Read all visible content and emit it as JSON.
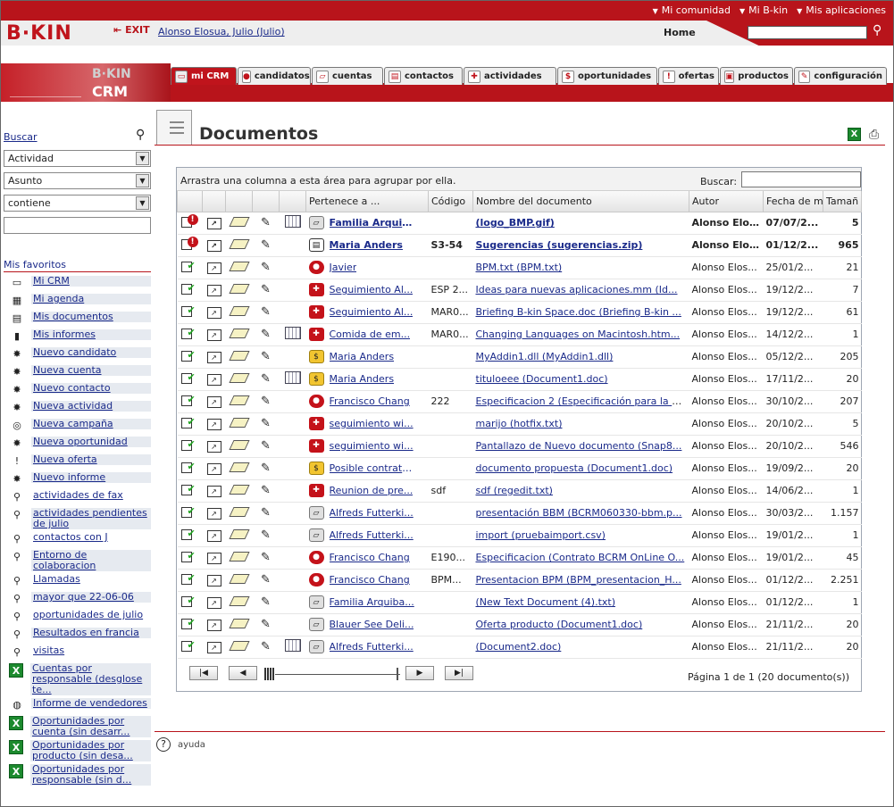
{
  "topbar": {
    "links": [
      "Mi comunidad",
      "Mi B-kin",
      "Mis aplicaciones"
    ]
  },
  "header": {
    "logo": "B·KIN",
    "exit_label": "EXIT",
    "user": "Alonso Elosua, Julio (Julio)",
    "home": "Home",
    "search_value": ""
  },
  "crm_band": {
    "brand": "B·KIN",
    "product": "CRM"
  },
  "tabs": [
    {
      "label": "mi CRM",
      "icon": "monitor-icon",
      "active": true
    },
    {
      "label": "candidatos",
      "icon": "person-icon"
    },
    {
      "label": "cuentas",
      "icon": "folder-icon"
    },
    {
      "label": "contactos",
      "icon": "contact-card-icon"
    },
    {
      "label": "actividades",
      "icon": "activity-icon"
    },
    {
      "label": "oportunidades",
      "icon": "coins-icon"
    },
    {
      "label": "ofertas",
      "icon": "exclamation-icon"
    },
    {
      "label": "productos",
      "icon": "box-icon"
    },
    {
      "label": "configuración",
      "icon": "wrench-icon"
    }
  ],
  "sidebar": {
    "buscar": "Buscar",
    "filters": [
      "Actividad",
      "Asunto",
      "contiene"
    ],
    "text_value": "",
    "fav_title": "Mis favoritos",
    "favs": [
      {
        "label": "Mi CRM",
        "icon": "monitor-icon"
      },
      {
        "label": "Mi agenda",
        "icon": "calendar-icon"
      },
      {
        "label": "Mis documentos",
        "icon": "document-icon"
      },
      {
        "label": "Mis informes",
        "icon": "bar-chart-icon"
      },
      {
        "label": "Nuevo candidato",
        "icon": "new-candidate-icon"
      },
      {
        "label": "Nueva cuenta",
        "icon": "new-account-icon"
      },
      {
        "label": "Nuevo contacto",
        "icon": "new-contact-icon"
      },
      {
        "label": "Nueva actividad",
        "icon": "new-activity-icon"
      },
      {
        "label": "Nueva campaña",
        "icon": "new-campaign-icon"
      },
      {
        "label": "Nueva oportunidad",
        "icon": "new-opportunity-icon"
      },
      {
        "label": "Nueva oferta",
        "icon": "new-offer-icon"
      },
      {
        "label": "Nuevo informe",
        "icon": "new-report-icon"
      },
      {
        "label": "actividades de fax",
        "icon": "magnifier-icon"
      },
      {
        "label": "actividades pendientes de julio",
        "icon": "magnifier-icon"
      },
      {
        "label": "contactos con J",
        "icon": "magnifier-icon"
      },
      {
        "label": "Entorno de colaboracion",
        "icon": "magnifier-icon"
      },
      {
        "label": "Llamadas",
        "icon": "magnifier-icon"
      },
      {
        "label": "mayor que 22-06-06",
        "icon": "magnifier-icon"
      },
      {
        "label": "oportunidades de julio",
        "icon": "magnifier-icon"
      },
      {
        "label": "Resultados en francia",
        "icon": "magnifier-icon"
      },
      {
        "label": "visitas",
        "icon": "magnifier-icon"
      },
      {
        "label": "Cuentas por responsable (desglose te...",
        "icon": "excel-icon"
      },
      {
        "label": "Informe de vendedores",
        "icon": "globe-icon"
      },
      {
        "label": "Oportunidades por cuenta (sin desarr...",
        "icon": "excel-icon"
      },
      {
        "label": "Oportunidades por producto (sin desa...",
        "icon": "excel-icon"
      },
      {
        "label": "Oportunidades por responsable (sin d...",
        "icon": "excel-icon"
      }
    ]
  },
  "main": {
    "title": "Documentos",
    "group_hint": "Arrastra una columna a esta área para agrupar por ella.",
    "search_label": "Buscar:",
    "columns": [
      "Pertenece a ...",
      "Código",
      "Nombre del documento",
      "Autor",
      "Fecha de m",
      "Tamañ"
    ],
    "rows": [
      {
        "state": "bad",
        "cal": true,
        "type": "cuentas",
        "pertenece": "Familia Arquib...",
        "codigo": "",
        "nombre": "(logo_BMP.gif)",
        "autor": "Alonso Elos...",
        "fecha": "07/07/2...",
        "tam": "5",
        "bold": true
      },
      {
        "state": "bad",
        "cal": false,
        "type": "contactos",
        "pertenece": "Maria Anders",
        "codigo": "S3-54",
        "nombre": "Sugerencias (sugerencias.zip)",
        "autor": "Alonso Elos...",
        "fecha": "01/12/2...",
        "tam": "965",
        "bold": true
      },
      {
        "state": "ok",
        "cal": false,
        "type": "candidatos",
        "pertenece": "Javier",
        "codigo": "",
        "nombre": "BPM.txt (BPM.txt)",
        "autor": "Alonso Elos...",
        "fecha": "25/01/2...",
        "tam": "21"
      },
      {
        "state": "ok",
        "cal": false,
        "type": "actividades",
        "pertenece": "Seguimiento Al...",
        "codigo": "ESP 2...",
        "nombre": "Ideas para nuevas aplicaciones.mm (Id...",
        "autor": "Alonso Elos...",
        "fecha": "19/12/2...",
        "tam": "7"
      },
      {
        "state": "ok",
        "cal": false,
        "type": "actividades",
        "pertenece": "Seguimiento Al...",
        "codigo": "MAR0...",
        "nombre": "Briefing B-kin Space.doc (Briefing B-kin ...",
        "autor": "Alonso Elos...",
        "fecha": "19/12/2...",
        "tam": "61"
      },
      {
        "state": "ok",
        "cal": true,
        "type": "actividades",
        "pertenece": "Comida de em...",
        "codigo": "MAR0...",
        "nombre": "Changing Languages on Macintosh.htm...",
        "autor": "Alonso Elos...",
        "fecha": "14/12/2...",
        "tam": "1"
      },
      {
        "state": "ok",
        "cal": false,
        "type": "oportunidades",
        "pertenece": "Maria Anders",
        "codigo": "",
        "nombre": "MyAddin1.dll (MyAddin1.dll)",
        "autor": "Alonso Elos...",
        "fecha": "05/12/2...",
        "tam": "205"
      },
      {
        "state": "ok",
        "cal": true,
        "type": "oportunidades",
        "pertenece": "Maria Anders",
        "codigo": "",
        "nombre": "tituloeee (Document1.doc)",
        "autor": "Alonso Elos...",
        "fecha": "17/11/2...",
        "tam": "20"
      },
      {
        "state": "ok",
        "cal": false,
        "type": "candidatos",
        "pertenece": "Francisco Chang",
        "codigo": "222",
        "nombre": "Especificacion 2 (Especificación para la a...",
        "autor": "Alonso Elos...",
        "fecha": "30/10/2...",
        "tam": "207"
      },
      {
        "state": "ok",
        "cal": false,
        "type": "actividades",
        "pertenece": "seguimiento wi...",
        "codigo": "",
        "nombre": "marijo (hotfix.txt)",
        "autor": "Alonso Elos...",
        "fecha": "20/10/2...",
        "tam": "5"
      },
      {
        "state": "ok",
        "cal": false,
        "type": "actividades",
        "pertenece": "seguimiento wi...",
        "codigo": "",
        "nombre": "Pantallazo de Nuevo documento (Snap8...",
        "autor": "Alonso Elos...",
        "fecha": "20/10/2...",
        "tam": "546"
      },
      {
        "state": "ok",
        "cal": false,
        "type": "oportunidades",
        "pertenece": "Posible contrata...",
        "codigo": "",
        "nombre": "documento propuesta (Document1.doc)",
        "autor": "Alonso Elos...",
        "fecha": "19/09/2...",
        "tam": "20"
      },
      {
        "state": "ok",
        "cal": false,
        "type": "actividades",
        "pertenece": "Reunion de pre...",
        "codigo": "sdf",
        "nombre": "sdf (regedit.txt)",
        "autor": "Alonso Elos...",
        "fecha": "14/06/2...",
        "tam": "1"
      },
      {
        "state": "ok",
        "cal": false,
        "type": "cuentas",
        "pertenece": "Alfreds Futterki...",
        "codigo": "",
        "nombre": "presentación BBM (BCRM060330-bbm.p...",
        "autor": "Alonso Elos...",
        "fecha": "30/03/2...",
        "tam": "1.157"
      },
      {
        "state": "ok",
        "cal": false,
        "type": "cuentas",
        "pertenece": "Alfreds Futterki...",
        "codigo": "",
        "nombre": "import (pruebaimport.csv)",
        "autor": "Alonso Elos...",
        "fecha": "19/01/2...",
        "tam": "1"
      },
      {
        "state": "ok",
        "cal": false,
        "type": "candidatos",
        "pertenece": "Francisco Chang",
        "codigo": "E190...",
        "nombre": "Especificacion (Contrato BCRM OnLine O...",
        "autor": "Alonso Elos...",
        "fecha": "19/01/2...",
        "tam": "45"
      },
      {
        "state": "ok",
        "cal": false,
        "type": "candidatos",
        "pertenece": "Francisco Chang",
        "codigo": "BPM...",
        "nombre": "Presentacion BPM (BPM_presentacion_H...",
        "autor": "Alonso Elos...",
        "fecha": "01/12/2...",
        "tam": "2.251"
      },
      {
        "state": "ok",
        "cal": false,
        "type": "cuentas",
        "pertenece": "Familia Arquiba...",
        "codigo": "",
        "nombre": "(New Text Document (4).txt)",
        "autor": "Alonso Elos...",
        "fecha": "01/12/2...",
        "tam": "1"
      },
      {
        "state": "ok",
        "cal": false,
        "type": "cuentas",
        "pertenece": "Blauer See Deli...",
        "codigo": "",
        "nombre": "Oferta producto (Document1.doc)",
        "autor": "Alonso Elos...",
        "fecha": "21/11/2...",
        "tam": "20"
      },
      {
        "state": "ok",
        "cal": true,
        "type": "cuentas",
        "pertenece": "Alfreds Futterki...",
        "codigo": "",
        "nombre": "(Document2.doc)",
        "autor": "Alonso Elos...",
        "fecha": "21/11/2...",
        "tam": "20"
      }
    ],
    "pager_info": "Página 1 de 1 (20 documento(s))"
  },
  "footer": {
    "help": "ayuda"
  },
  "colors": {
    "brand_red": "#b8141b",
    "link_blue": "#1a2a8a",
    "ok_green": "#1ea31e"
  }
}
